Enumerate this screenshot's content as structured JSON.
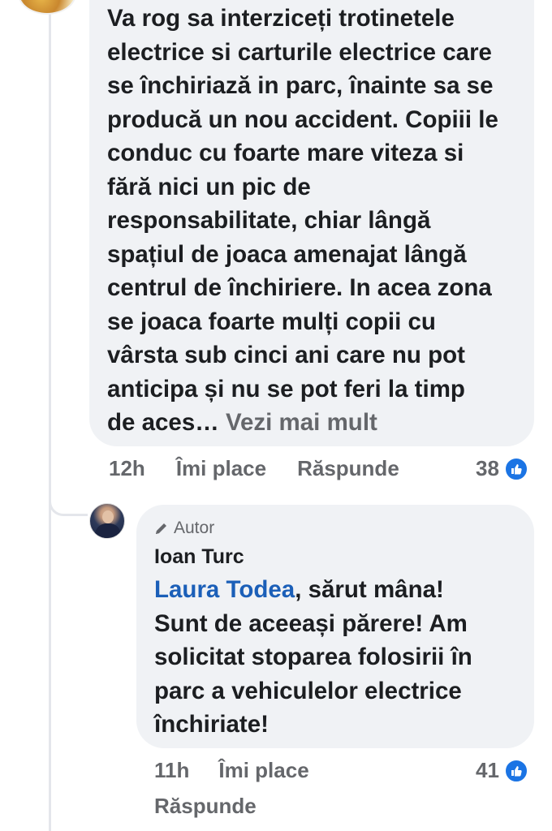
{
  "comment": {
    "text": "Va rog sa interziceți trotinetele\nelectrice si carturile electrice care\nse închiriază in parc, înainte sa se\nproducă un nou accident. Copiii le\nconduc cu foarte mare viteza si\nfără nici un pic de\nresponsabilitate, chiar lângă\nspațiul de joaca amenajat lângă\ncentrul de închiriere. In acea zona\nse joaca foarte mulți copii cu\nvârsta sub cinci ani care nu pot\nanticipa și nu se pot feri la timp\nde aces…",
    "see_more": "Vezi mai mult",
    "time": "12h",
    "like_label": "Îmi place",
    "reply_label": "Răspunde",
    "reaction_count": "38"
  },
  "reply": {
    "badge": "Autor",
    "author": "Ioan Turc",
    "mention": "Laura Todea",
    "text_after_mention": ", sărut mâna!\nSunt de aceeași părere! Am\nsolicitat stoparea folosirii în\nparc a vehiculelor electrice\nînchiriate!",
    "time": "11h",
    "like_label": "Îmi place",
    "reply_label": "Răspunde",
    "reaction_count": "41"
  },
  "colors": {
    "bubble": "#f0f2f5",
    "text": "#1c1e21",
    "secondary": "#65676b",
    "link": "#1b5fb8",
    "like_blue": "#1b74e4"
  },
  "icons": {
    "like": "thumbs-up-icon",
    "author_badge": "pencil-icon"
  }
}
